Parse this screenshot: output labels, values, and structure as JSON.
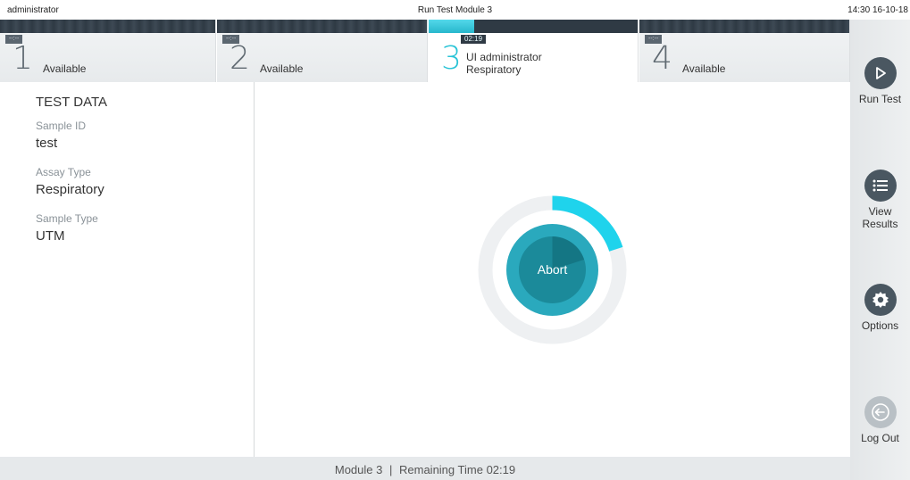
{
  "topbar": {
    "user": "administrator",
    "title": "Run Test Module 3",
    "clock": "14:30 16-10-18"
  },
  "tabs": [
    {
      "time": "--:--",
      "number": "1",
      "status": "Available"
    },
    {
      "time": "--:--",
      "number": "2",
      "status": "Available"
    },
    {
      "time": "02:19",
      "number": "3",
      "user": "UI administrator",
      "assay": "Respiratory",
      "progress": 0.22
    },
    {
      "time": "--:--",
      "number": "4",
      "status": "Available"
    }
  ],
  "test_data": {
    "header": "TEST DATA",
    "sample_id_label": "Sample ID",
    "sample_id": "test",
    "assay_type_label": "Assay Type",
    "assay_type": "Respiratory",
    "sample_type_label": "Sample Type",
    "sample_type": "UTM"
  },
  "progress": {
    "abort_label": "Abort",
    "fraction": 0.2,
    "accent_color": "#1fd3ec",
    "track_color": "#eef0f2"
  },
  "sidebar": {
    "run_test": "Run Test",
    "view_results_line1": "View",
    "view_results_line2": "Results",
    "options": "Options",
    "log_out": "Log Out"
  },
  "footer": {
    "module": "Module 3",
    "separator": "|",
    "remaining_label": "Remaining Time",
    "remaining_time": "02:19"
  }
}
